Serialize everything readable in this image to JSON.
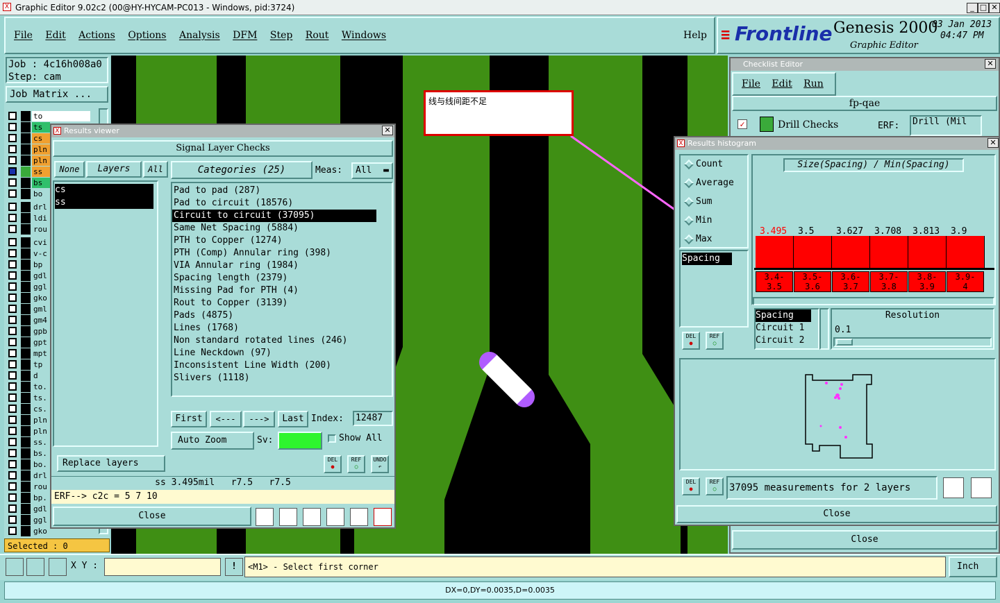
{
  "window": {
    "title": "Graphic Editor 9.02c2 (00@HY-HYCAM-PC013 - Windows, pid:3724)"
  },
  "menu": {
    "items": [
      "File",
      "Edit",
      "Actions",
      "Options",
      "Analysis",
      "DFM",
      "Step",
      "Rout",
      "Windows"
    ],
    "help": "Help"
  },
  "brand": {
    "logo": "Frontline",
    "product": "Genesis 2000",
    "subtitle": "Graphic Editor",
    "date": "03 Jan 2013",
    "time": "04:47 PM"
  },
  "job": {
    "job_line": "Job : 4c16h008a0",
    "step_line": "Step: cam",
    "matrix_button": "Job Matrix ..."
  },
  "layers": {
    "list": [
      "to",
      "ts",
      "cs",
      "pln",
      "pln",
      "ss",
      "bs",
      "bo",
      "drl",
      "ldi",
      "rou",
      "cvi",
      "v-c",
      "bp",
      "gdl",
      "ggl",
      "gko",
      "gml",
      "gm4",
      "gpb",
      "gpt",
      "mpt",
      "tp",
      "d",
      "to.",
      "ts.",
      "cs.",
      "pln",
      "pln",
      "ss.",
      "bs.",
      "bo.",
      "drl",
      "rou",
      "bp.",
      "gdl",
      "ggl",
      "gko d"
    ],
    "selected": "Selected : 0"
  },
  "annotation": {
    "note": "线与线间距不足"
  },
  "results_viewer": {
    "title": "Results viewer",
    "header": "Signal Layer Checks",
    "none_btn": "None",
    "layers_btn": "Layers",
    "all_btn": "All",
    "layer_items": [
      "cs",
      "ss"
    ],
    "categories_btn": "Categories (25)",
    "meas_label": "Meas:",
    "meas_value": "All",
    "categories": [
      "Pad to pad (287)",
      "Pad to circuit (18576)",
      "Circuit to circuit (37095)",
      "Same Net Spacing (5884)",
      "PTH to Copper (1274)",
      "PTH (Comp) Annular ring (398)",
      "VIA Annular ring (1984)",
      "Spacing length (2379)",
      "Missing Pad for PTH (4)",
      "Rout to Copper (3139)",
      "Pads (4875)",
      "Lines (1768)",
      "Non standard rotated lines (246)",
      "Line Neckdown (97)",
      "Inconsistent Line Width (200)",
      "Slivers (1118)"
    ],
    "nav": {
      "first": "First",
      "prev": "<---",
      "next": "--->",
      "last": "Last",
      "index_label": "Index:",
      "index_value": "12487"
    },
    "auto_zoom": "Auto Zoom",
    "sv_label": "Sv:",
    "show_all": "Show All",
    "replace_layers": "Replace layers",
    "del": "DEL",
    "ref": "REF",
    "undo": "UNDO",
    "status1": "ss 3.495mil   r7.5   r7.5",
    "status2": "ERF--> c2c = 5 7 10",
    "close": "Close"
  },
  "checklist": {
    "title": "Checklist Editor",
    "menu": [
      "File",
      "Edit",
      "Run"
    ],
    "name": "fp-qae",
    "item": "Drill Checks",
    "erf_label": "ERF:",
    "erf_value": "Drill (Mil",
    "close": "Close"
  },
  "histogram": {
    "title": "Results histogram",
    "options": [
      "Count",
      "Average",
      "Sum",
      "Min",
      "Max"
    ],
    "attr_selected": "Spacing",
    "header": "Size(Spacing) / Min(Spacing)",
    "bar_values": [
      "3.495",
      "3.5",
      "3.627",
      "3.708",
      "3.813",
      "3.9"
    ],
    "bar_ranges": [
      "3.4-\n3.5",
      "3.5-\n3.6",
      "3.6-\n3.7",
      "3.7-\n3.8",
      "3.8-\n3.9",
      "3.9-\n4"
    ],
    "fields": [
      "Spacing",
      "Circuit 1",
      "Circuit 2"
    ],
    "resolution_label": "Resolution",
    "resolution_value": "0.1",
    "del": "DEL",
    "ref": "REF",
    "summary": "37095 measurements for 2 layers",
    "close": "Close"
  },
  "bottom": {
    "xy_label": "X Y :",
    "xy_value": "",
    "prompt": "<M1> - Select first corner",
    "units": "Inch",
    "status": "DX=0,DY=0.0035,D=0.0035"
  },
  "colors": {
    "background": "#9bd6d2",
    "pcb_green": "#3f8f14",
    "highlight_red": "#ff0000",
    "magenta": "#ff33ff"
  }
}
